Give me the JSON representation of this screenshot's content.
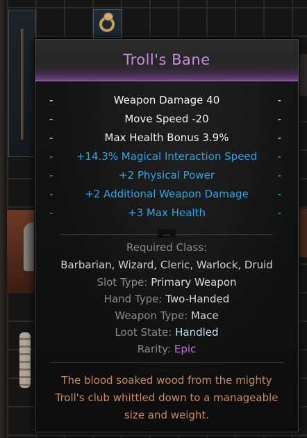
{
  "item": {
    "name": "Troll's Bane",
    "name_color": "#c78bdd",
    "stats": [
      {
        "text": "Weapon Damage 40",
        "kind": "base"
      },
      {
        "text": "Move Speed -20",
        "kind": "base"
      },
      {
        "text": "Max Health Bonus 3.9%",
        "kind": "base"
      },
      {
        "text": "+14.3% Magical Interaction Speed",
        "kind": "bonus"
      },
      {
        "text": "+2 Physical Power",
        "kind": "bonus"
      },
      {
        "text": "+2 Additional Weapon Damage",
        "kind": "bonus"
      },
      {
        "text": "+3 Max Health",
        "kind": "bonus"
      }
    ],
    "divider_dots": "...",
    "required_class_label": "Required Class:",
    "required_classes": "Barbarian, Wizard, Cleric, Warlock, Druid",
    "slot_type_label": "Slot Type:",
    "slot_type": "Primary Weapon",
    "hand_type_label": "Hand Type:",
    "hand_type": "Two-Handed",
    "weapon_type_label": "Weapon Type:",
    "weapon_type": "Mace",
    "loot_state_label": "Loot State:",
    "loot_state": "Handled",
    "rarity_label": "Rarity:",
    "rarity": "Epic",
    "flavor_lines": [
      "The blood soaked wood from the mighty",
      "Troll's club whittled down to a manageable",
      "size and weight."
    ]
  },
  "colors": {
    "base_stat": "#f2f2f2",
    "bonus_stat": "#2fa4e0",
    "epic": "#c070d8",
    "flavor": "#c98a5e"
  },
  "inventory_icons": [
    "staff-icon",
    "ring-icon",
    "helmet-icon",
    "armor-leg-icon"
  ]
}
